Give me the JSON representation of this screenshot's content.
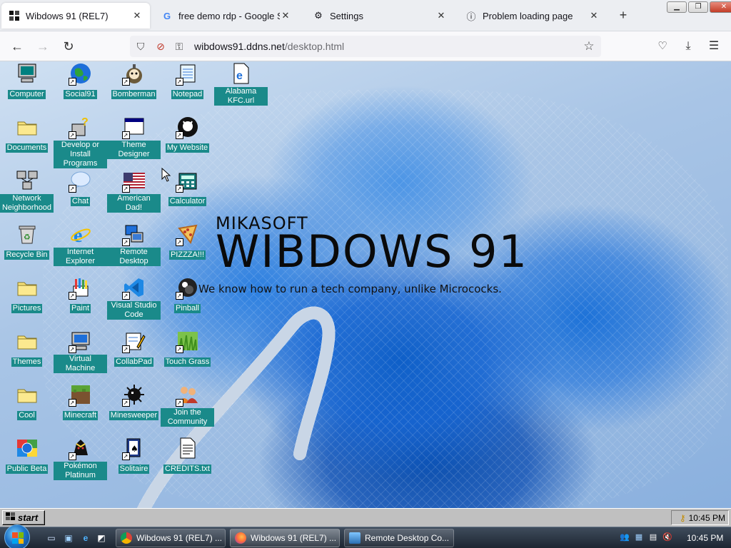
{
  "browser": {
    "tabs": [
      {
        "title": "Wibdows 91 (REL7)",
        "icon": "wibdows-icon",
        "active": true
      },
      {
        "title": "free demo rdp - Google Search",
        "icon": "google-icon",
        "active": false
      },
      {
        "title": "Settings",
        "icon": "gear-icon",
        "active": false
      },
      {
        "title": "Problem loading page",
        "icon": "info-icon",
        "active": false
      }
    ],
    "url_host": "wibdows91.ddns.net",
    "url_path": "/desktop.html"
  },
  "desktop": {
    "icons": [
      {
        "label": "Computer",
        "icon": "computer-icon",
        "shortcut": false
      },
      {
        "label": "Social91",
        "icon": "globe-icon",
        "shortcut": true
      },
      {
        "label": "Bomberman",
        "icon": "bomberman-icon",
        "shortcut": true
      },
      {
        "label": "Notepad",
        "icon": "notepad-icon",
        "shortcut": true
      },
      {
        "label": "Alabama KFC.url",
        "icon": "ie-file-icon",
        "shortcut": false
      },
      {
        "label": "Documents",
        "icon": "folder-icon",
        "shortcut": false
      },
      {
        "label": "Develop or Install Programs",
        "icon": "install-icon",
        "shortcut": true
      },
      {
        "label": "Theme Designer",
        "icon": "window-icon",
        "shortcut": true
      },
      {
        "label": "My Website",
        "icon": "github-icon",
        "shortcut": true
      },
      {
        "label": "Network Neighborhood",
        "icon": "network-icon",
        "shortcut": false
      },
      {
        "label": "Chat",
        "icon": "chat-bubble-icon",
        "shortcut": true
      },
      {
        "label": "American Dad!",
        "icon": "us-flag-icon",
        "shortcut": true
      },
      {
        "label": "Calculator",
        "icon": "calculator-icon",
        "shortcut": true
      },
      {
        "label": "Recycle Bin",
        "icon": "recycle-bin-icon",
        "shortcut": false
      },
      {
        "label": "Internet Explorer",
        "icon": "ie-icon",
        "shortcut": false
      },
      {
        "label": "Remote Desktop",
        "icon": "remote-desktop-icon",
        "shortcut": true
      },
      {
        "label": "PIZZZA!!!",
        "icon": "pizza-icon",
        "shortcut": true
      },
      {
        "label": "Pictures",
        "icon": "folder-icon",
        "shortcut": false
      },
      {
        "label": "Paint",
        "icon": "paint-icon",
        "shortcut": true
      },
      {
        "label": "Visual Studio Code",
        "icon": "vscode-icon",
        "shortcut": true
      },
      {
        "label": "Pinball",
        "icon": "pinball-icon",
        "shortcut": true
      },
      {
        "label": "Themes",
        "icon": "folder-icon",
        "shortcut": false
      },
      {
        "label": "Virtual Machine",
        "icon": "virtual-machine-icon",
        "shortcut": true
      },
      {
        "label": "CollabPad",
        "icon": "collabpad-icon",
        "shortcut": true
      },
      {
        "label": "Touch Grass",
        "icon": "grass-icon",
        "shortcut": true
      },
      {
        "label": "Cool",
        "icon": "folder-icon",
        "shortcut": false
      },
      {
        "label": "Minecraft",
        "icon": "minecraft-icon",
        "shortcut": true
      },
      {
        "label": "Minesweeper",
        "icon": "mine-icon",
        "shortcut": true
      },
      {
        "label": "Join the Community",
        "icon": "people-icon",
        "shortcut": true
      },
      {
        "label": "Public Beta",
        "icon": "public-beta-icon",
        "shortcut": false
      },
      {
        "label": "Pokémon Platinum",
        "icon": "pokemon-icon",
        "shortcut": true
      },
      {
        "label": "Solitaire",
        "icon": "solitaire-icon",
        "shortcut": true
      },
      {
        "label": "CREDITS.txt",
        "icon": "text-file-icon",
        "shortcut": false
      }
    ],
    "brand_small": "MIKASOFT",
    "brand_big": "WIBDOWS 91",
    "tagline": "We know how to run a tech company, unlike Micrococks."
  },
  "taskbar95": {
    "start_label": "start",
    "clock": "10:45 PM"
  },
  "taskbar7": {
    "tasks": [
      {
        "label": "Wibdows 91 (REL7) ...",
        "icon": "chrome-icon",
        "active": false
      },
      {
        "label": "Wibdows 91 (REL7) ...",
        "icon": "firefox-icon",
        "active": true
      },
      {
        "label": "Remote Desktop Co...",
        "icon": "remote-desktop-icon",
        "active": false
      }
    ],
    "clock": "10:45 PM"
  },
  "colors": {
    "icon_label_bg": "#1a8a8a",
    "win95_gray": "#c0c0c0",
    "win7_taskbar": "#1d2632"
  }
}
